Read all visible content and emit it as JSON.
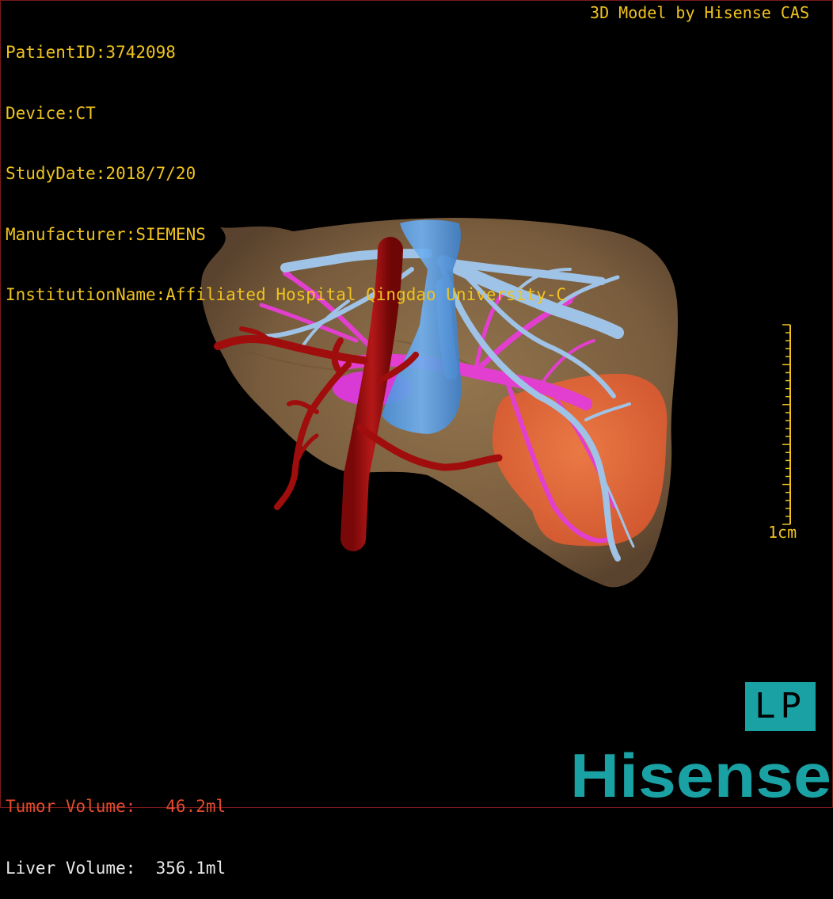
{
  "header": {
    "patient_id": "PatientID:3742098",
    "device": "Device:CT",
    "study_date": "StudyDate:2018/7/20",
    "manufacturer": "Manufacturer:SIEMENS",
    "institution": "InstitutionName:Affiliated Hospital Qingdao University-C",
    "credit": "3D Model by Hisense CAS"
  },
  "scale_bar": {
    "label": "1cm"
  },
  "orientation": {
    "label": "LP"
  },
  "volumes": {
    "tumor": "Tumor Volume:   46.2ml",
    "liver": "Liver Volume:  356.1ml"
  },
  "brand": {
    "logo_text": "Hisense",
    "color": "#1aa1a4"
  },
  "colors": {
    "overlay_text": "#f0c31f",
    "liver": "#8a6a45",
    "tumor": "#e8663a",
    "portal_vein": "#e23fd0",
    "hepatic_vein": "#9fc3e6",
    "ivc": "#5aa0e8",
    "artery": "#9e0d0d"
  }
}
